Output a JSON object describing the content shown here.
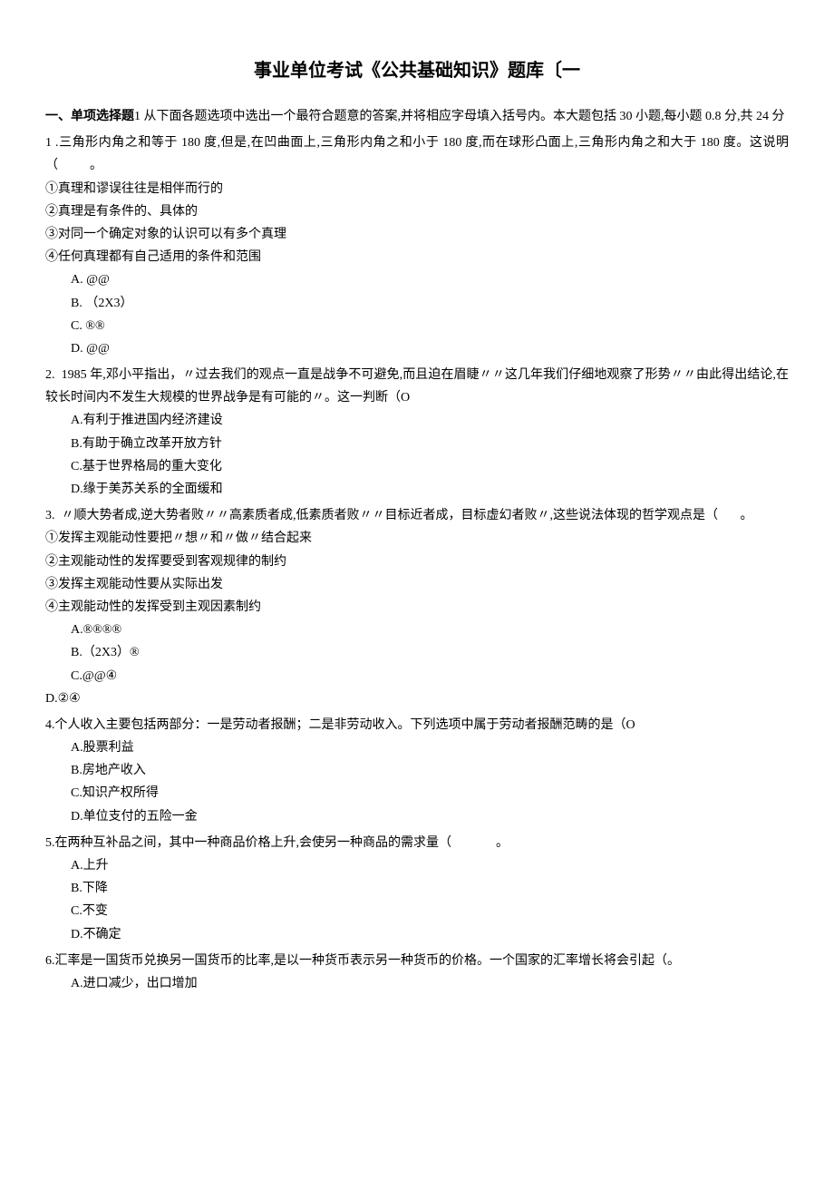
{
  "title": "事业单位考试《公共基础知识》题库〔一",
  "section": {
    "label": "一、单项选择题",
    "instruction": "1 从下面各题选项中选出一个最符合题意的答案,并将相应字母填入括号内。本大题包括 30 小题,每小题 0.8 分,共 24 分"
  },
  "q1": {
    "num": "1",
    "text": ".三角形内角之和等于 180 度,但是,在凹曲面上,三角形内角之和小于 180 度,而在球形凸面上,三角形内角之和大于 180 度。这说明（",
    "blank": "。",
    "sub1": "①真理和谬误往往是相伴而行的",
    "sub2": "②真理是有条件的、具体的",
    "sub3": "③对同一个确定对象的认识可以有多个真理",
    "sub4": "④任何真理都有自己适用的条件和范围",
    "optA": "A.    @@",
    "optB": "B.    （2X3）",
    "optC": "C.    ®®",
    "optD": "D.    @@"
  },
  "q2": {
    "num": "2.",
    "text": "1985 年,邓小平指出，〃过去我们的观点一直是战争不可避免,而且迫在眉睫〃〃这几年我们仔细地观察了形势〃〃由此得出结论,在较长时间内不发生大规模的世界战争是有可能的〃。这一判断（O",
    "optA": "A.有利于推进国内经济建设",
    "optB": "B.有助于确立改革开放方针",
    "optC": "C.基于世界格局的重大变化",
    "optD": "D.缘于美苏关系的全面缓和"
  },
  "q3": {
    "num": "3.",
    "text": "〃顺大势者成,逆大势者败〃〃高素质者成,低素质者败〃〃目标近者成，目标虚幻者败〃,这些说法体现的哲学观点是（",
    "blank": "。",
    "sub1": "①发挥主观能动性要把〃想〃和〃做〃结合起来",
    "sub2": "②主观能动性的发挥要受到客观规律的制约",
    "sub3": "③发挥主观能动性要从实际出发",
    "sub4": "④主观能动性的发挥受到主观因素制约",
    "optA": "A.®®®®",
    "optB": "B.（2X3）®",
    "optC": "C.@@④",
    "optD": "D.②④"
  },
  "q4": {
    "num": "4.",
    "text": "个人收入主要包括两部分：一是劳动者报酬；二是非劳动收入。下列选项中属于劳动者报酬范畴的是（O",
    "optA": "A.股票利益",
    "optB": "B.房地产收入",
    "optC": "C.知识产权所得",
    "optD": "D.单位支付的五险一金"
  },
  "q5": {
    "num": "5.",
    "text": "在两种互补品之间，其中一种商品价格上升,会使另一种商品的需求量（",
    "blank": "。",
    "optA": "A.上升",
    "optB": "B.下降",
    "optC": "C.不变",
    "optD": "D.不确定"
  },
  "q6": {
    "num": "6.",
    "text": "汇率是一国货币兑换另一国货币的比率,是以一种货币表示另一种货币的价格。一个国家的汇率增长将会引起（。",
    "optA": "A.进口减少，出口增加"
  }
}
